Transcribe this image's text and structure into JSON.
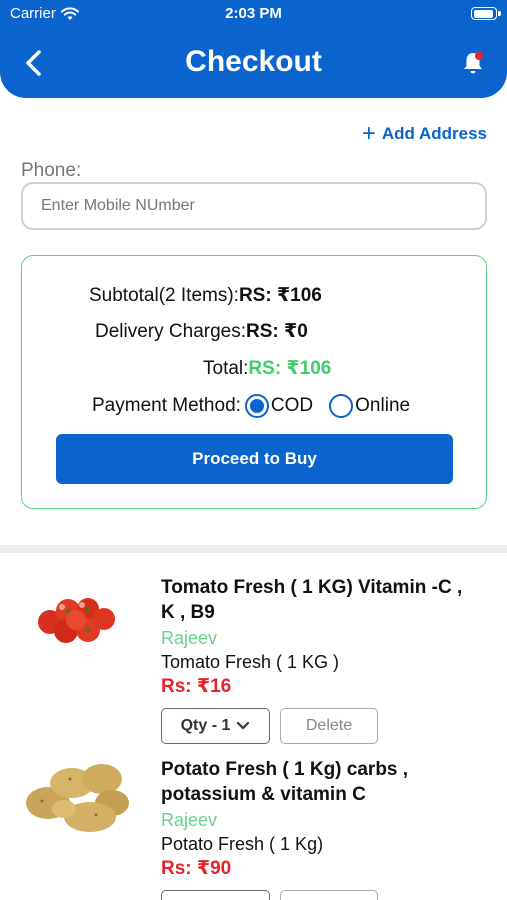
{
  "status": {
    "carrier": "Carrier",
    "time": "2:03 PM"
  },
  "header": {
    "title": "Checkout"
  },
  "actions": {
    "add_address": "Add Address"
  },
  "phone": {
    "label": "Phone:",
    "placeholder": "Enter Mobile NUmber",
    "value": ""
  },
  "summary": {
    "subtotal_label": "Subtotal(2 Items):",
    "subtotal_value": "RS: ₹106",
    "delivery_label": "Delivery Charges:",
    "delivery_value": "RS: ₹0",
    "total_label": "Total:",
    "total_value": "RS: ₹106",
    "payment_label": "Payment Method:",
    "payment_options": [
      {
        "label": "COD",
        "selected": true
      },
      {
        "label": "Online",
        "selected": false
      }
    ],
    "proceed_label": "Proceed to Buy"
  },
  "items": [
    {
      "name": "Tomato Fresh ( 1 KG) Vitamin -C , K , B9",
      "seller": "Rajeev",
      "subname": "Tomato Fresh ( 1 KG )",
      "price": "Rs: ₹16",
      "qty_label": "Qty - 1",
      "delete_label": "Delete"
    },
    {
      "name": "Potato Fresh ( 1 Kg) carbs , potassium & vitamin C",
      "seller": "Rajeev",
      "subname": "Potato Fresh ( 1 Kg)",
      "price": "Rs: ₹90"
    }
  ],
  "colors": {
    "primary": "#0b63ce",
    "green": "#3fcf6a",
    "price_red": "#e5232a"
  }
}
